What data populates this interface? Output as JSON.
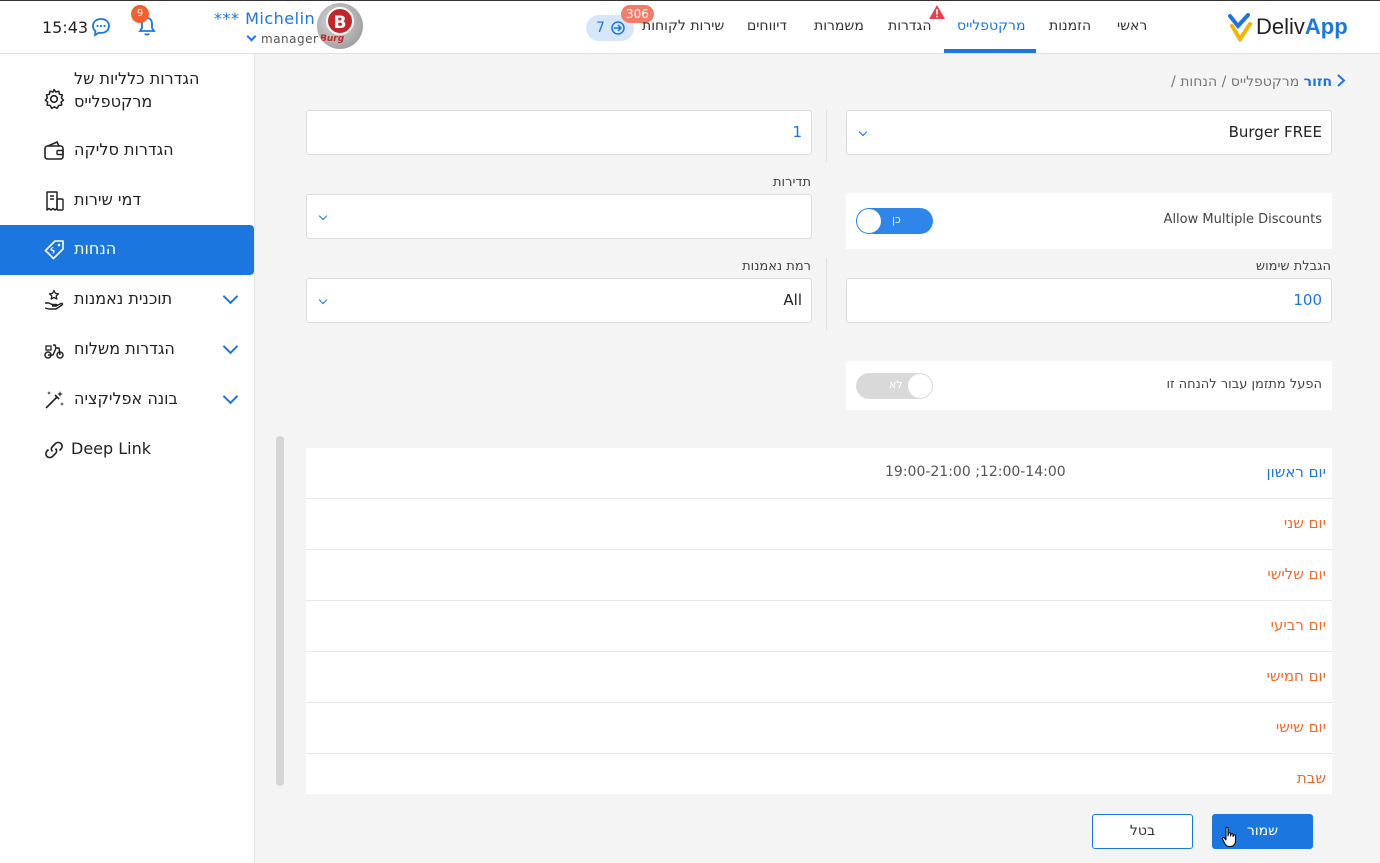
{
  "header": {
    "time": "15:43",
    "notifications_count": "9",
    "user_name": "*** Michelin",
    "user_role": "manager",
    "avatar_letter": "B",
    "avatar_caption": "Burg",
    "logo_prefix": "Deliv",
    "logo_suffix": "App",
    "service_count": "7",
    "service_badge": "306",
    "nav": [
      {
        "label": "ראשי"
      },
      {
        "label": "הזמנות"
      },
      {
        "label": "מרקטפלייס"
      },
      {
        "label": "הגדרות"
      },
      {
        "label": "משמרות"
      },
      {
        "label": "דיווחים"
      },
      {
        "label": "שירות לקוחות"
      }
    ]
  },
  "sidebar": {
    "items": [
      {
        "label_line1": "הגדרות כלליות של",
        "label_line2": "מרקטפלייס",
        "icon": "gear-icon"
      },
      {
        "label": "הגדרות סליקה",
        "icon": "wallet-icon"
      },
      {
        "label": "דמי שירות",
        "icon": "receipt-icon"
      },
      {
        "label": "הנחות",
        "icon": "discount-tag-icon"
      },
      {
        "label": "תוכנית נאמנות",
        "icon": "loyalty-hand-icon"
      },
      {
        "label": "הגדרות משלוח",
        "icon": "scooter-icon"
      },
      {
        "label": "בונה אפליקציה",
        "icon": "magic-wand-icon"
      },
      {
        "label": "Deep Link",
        "icon": "link-icon"
      }
    ]
  },
  "breadcrumb": {
    "back": "חזור",
    "path": "מרקטפלייס / הנחות /"
  },
  "form": {
    "business_select": "Burger FREE",
    "top_left_value": "1",
    "frequency_label": "תדירות",
    "frequency_value": "",
    "allow_multiple_label": "Allow Multiple Discounts",
    "allow_multiple_state": "כן",
    "usage_limit_label": "הגבלת שימוש",
    "usage_limit_value": "100",
    "loyalty_level_label": "רמת נאמנות",
    "loyalty_level_value": "All",
    "scheduler_label": "הפעל מתזמן עבור להנחה זו",
    "scheduler_state": "לא"
  },
  "schedule": [
    {
      "day": "יום ראשון",
      "hours": "19:00-21:00 ;12:00-14:00"
    },
    {
      "day": "יום שני",
      "hours": ""
    },
    {
      "day": "יום שלישי",
      "hours": ""
    },
    {
      "day": "יום רביעי",
      "hours": ""
    },
    {
      "day": "יום חמישי",
      "hours": ""
    },
    {
      "day": "יום שישי",
      "hours": ""
    },
    {
      "day": "שבת",
      "hours": ""
    }
  ],
  "buttons": {
    "save": "שמור",
    "cancel": "בטל"
  },
  "colors": {
    "accent": "#1b76e0",
    "day_inactive": "#f06a2c",
    "badge": "#f0612e"
  }
}
